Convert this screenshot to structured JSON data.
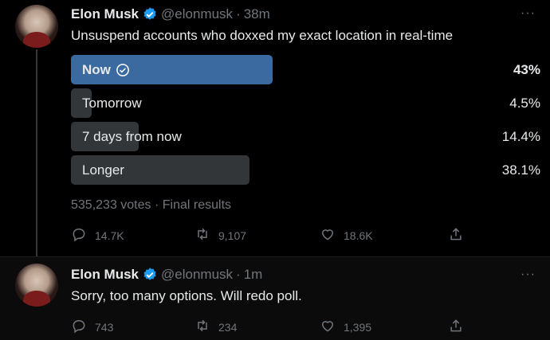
{
  "tweets": [
    {
      "name": "Elon Musk",
      "handle": "@elonmusk",
      "time": "38m",
      "text": "Unsuspend accounts who doxxed my exact location in real-time",
      "poll": {
        "options": [
          {
            "label": "Now",
            "percent": "43%",
            "share": 0.43,
            "winner": true
          },
          {
            "label": "Tomorrow",
            "percent": "4.5%",
            "share": 0.045,
            "winner": false
          },
          {
            "label": "7 days from now",
            "percent": "14.4%",
            "share": 0.144,
            "winner": false
          },
          {
            "label": "Longer",
            "percent": "38.1%",
            "share": 0.381,
            "winner": false
          }
        ],
        "votes": "535,233 votes",
        "status": "Final results"
      },
      "replies": "14.7K",
      "retweets": "9,107",
      "likes": "18.6K"
    },
    {
      "name": "Elon Musk",
      "handle": "@elonmusk",
      "time": "1m",
      "text": "Sorry, too many options. Will redo poll.",
      "replies": "743",
      "retweets": "234",
      "likes": "1,395"
    }
  ],
  "separator": "·",
  "more_glyph": "···",
  "colors": {
    "background": "#000000",
    "text": "#e7e9ea",
    "muted": "#71767b",
    "verified": "#1d9bf0",
    "winner_bar": "#3a6aa0",
    "bar": "#333639"
  },
  "icons": {
    "verified": "verified-badge-icon",
    "check": "check-circle-icon",
    "reply": "reply-icon",
    "retweet": "retweet-icon",
    "like": "heart-icon",
    "share": "share-icon",
    "more": "more-icon"
  }
}
